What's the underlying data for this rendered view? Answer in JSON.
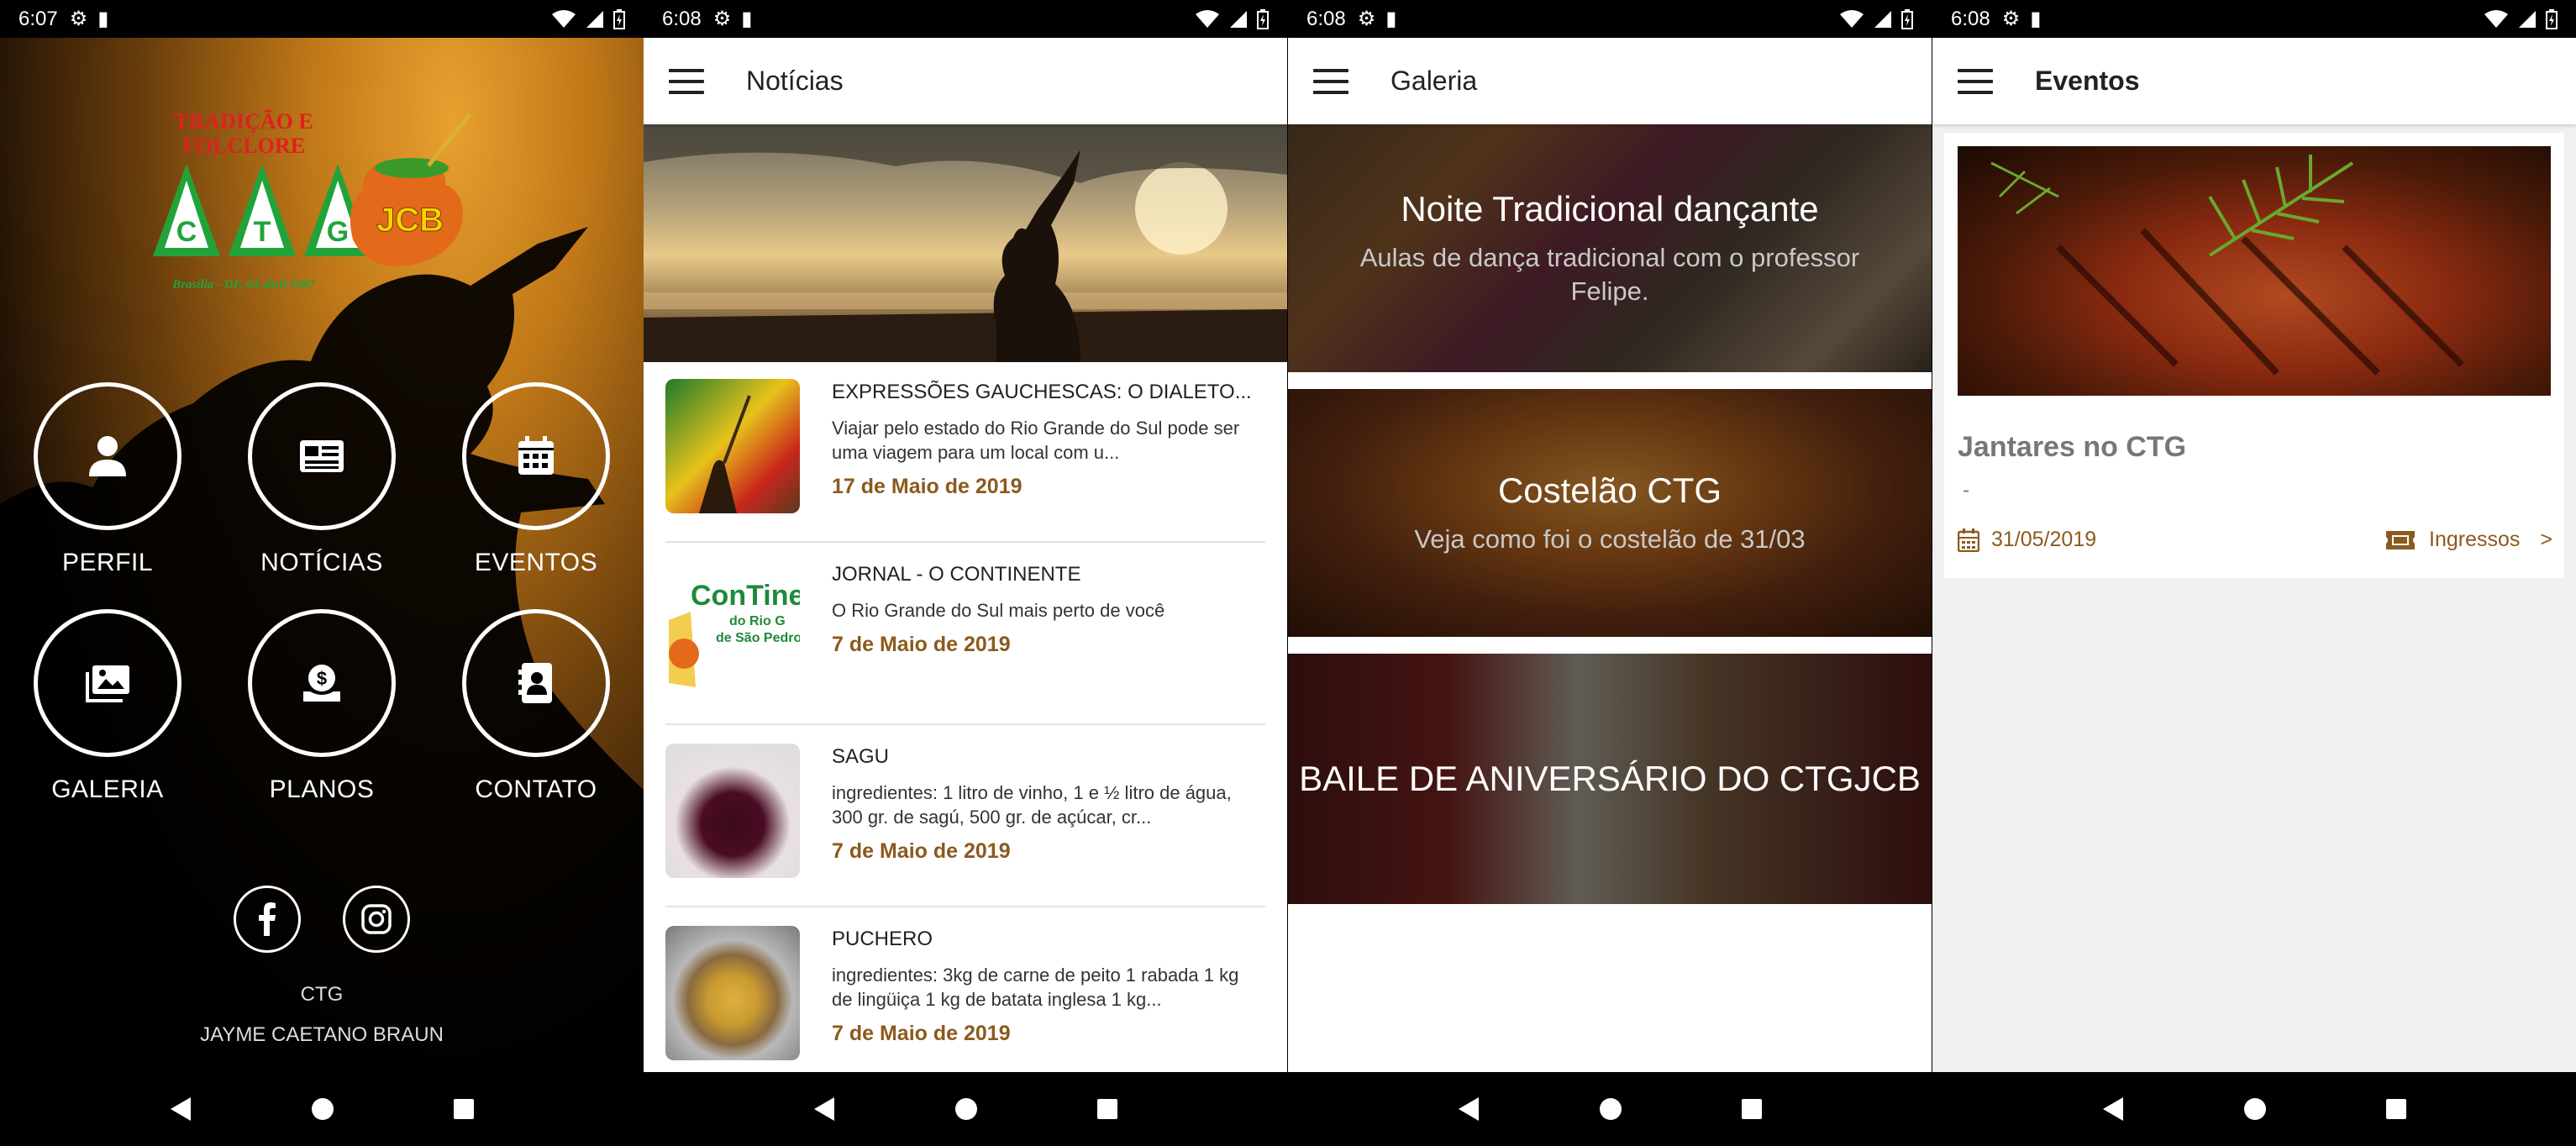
{
  "screens": {
    "home": {
      "status_time": "6:07",
      "logo": {
        "line1": "TRADIÇÃO E",
        "line2": "FOLCLORE",
        "letters": [
          "C",
          "T",
          "G"
        ],
        "jcb": "JCB",
        "founded": "Brasília - DF, 04 abril 1987"
      },
      "menu": [
        {
          "label": "PERFIL",
          "icon": "person-icon"
        },
        {
          "label": "NOTÍCIAS",
          "icon": "newspaper-icon"
        },
        {
          "label": "EVENTOS",
          "icon": "calendar-icon"
        },
        {
          "label": "GALERIA",
          "icon": "gallery-icon"
        },
        {
          "label": "PLANOS",
          "icon": "money-icon"
        },
        {
          "label": "CONTATO",
          "icon": "contact-card-icon"
        }
      ],
      "social": [
        "facebook-icon",
        "instagram-icon"
      ],
      "footer_line1": "CTG",
      "footer_line2": "JAYME CAETANO BRAUN"
    },
    "news": {
      "status_time": "6:08",
      "title": "Notícias",
      "items": [
        {
          "title": "EXPRESSÕES GAUCHESCAS: O DIALETO...",
          "desc": "Viajar pelo estado do Rio Grande do Sul pode ser uma viagem para um local com u...",
          "date": "17 de Maio de 2019"
        },
        {
          "title": "JORNAL - O CONTINENTE",
          "desc": "O Rio Grande do Sul mais perto de você",
          "date": "7 de Maio de 2019",
          "thumb_text": "ConTine",
          "thumb_sub1": "do Rio G",
          "thumb_sub2": "de São Pedro"
        },
        {
          "title": "SAGU",
          "desc": "ingredientes: 1 litro de vinho, 1 e ½ litro de água, 300 gr. de sagú, 500 gr. de açúcar, cr...",
          "date": "7 de Maio de 2019"
        },
        {
          "title": "PUCHERO",
          "desc": "ingredientes: 3kg de carne de peito 1 rabada 1 kg de lingüiça 1 kg de batata inglesa 1 kg...",
          "date": "7 de Maio de 2019"
        }
      ]
    },
    "gallery": {
      "status_time": "6:08",
      "title": "Galeria",
      "items": [
        {
          "title": "Noite Tradicional dançante",
          "subtitle": "Aulas de dança tradicional com o professor Felipe."
        },
        {
          "title": "Costelão CTG",
          "subtitle": "Veja como foi o costelão de 31/03"
        },
        {
          "title": "BAILE DE ANIVERSÁRIO DO CTGJCB",
          "subtitle": ""
        }
      ]
    },
    "events": {
      "status_time": "6:08",
      "title": "Eventos",
      "items": [
        {
          "title": "Jantares no CTG",
          "desc": "-",
          "date": "31/05/2019",
          "action": "Ingressos",
          "chevron": ">"
        }
      ]
    }
  },
  "colors": {
    "accent": "#8b5a1e",
    "logo_red": "#e02020",
    "logo_green": "#22a33a",
    "logo_yellow": "#f5d300"
  }
}
